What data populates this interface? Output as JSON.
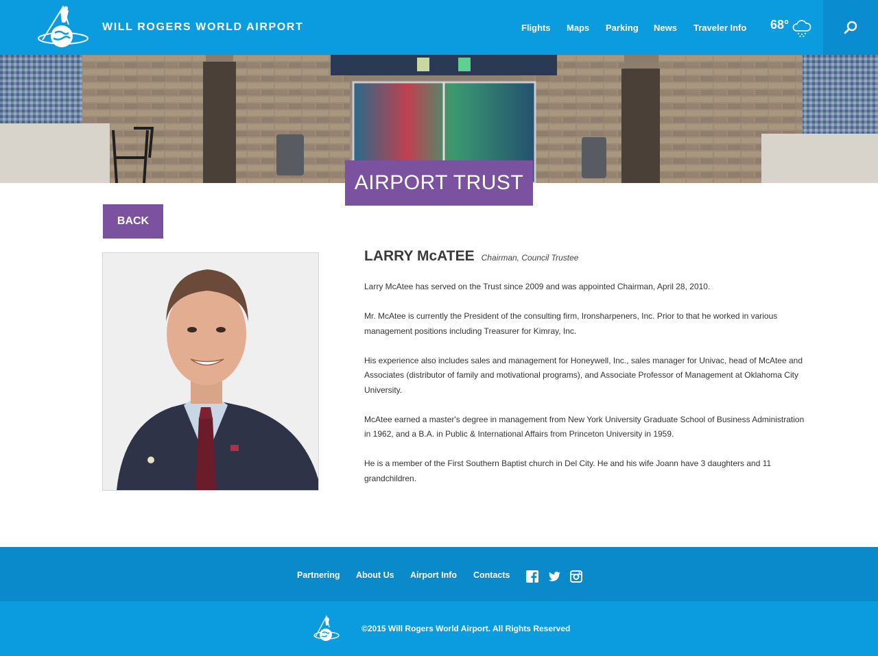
{
  "header": {
    "site_title": "WILL ROGERS WORLD AIRPORT",
    "nav": [
      "Flights",
      "Maps",
      "Parking",
      "News",
      "Traveler Info"
    ],
    "weather": {
      "temperature": "68°",
      "icon": "snow-cloud-icon"
    },
    "search_icon": "search-icon",
    "logo": "airport-logo"
  },
  "page": {
    "title": "AIRPORT TRUST",
    "back_label": "BACK"
  },
  "profile": {
    "name": "LARRY McATEE",
    "role": "Chairman, Council Trustee",
    "paragraphs": [
      "Larry McAtee has served on the Trust since 2009 and was appointed Chairman, April 28, 2010.",
      "Mr. McAtee is currently the President of the consulting firm, Ironsharpeners, Inc. Prior to that he worked in various management positions including Treasurer for Kimray, Inc.",
      "His experience also includes sales and management for Honeywell, Inc., sales manager for Univac, head of McAtee and Associates (distributor of family and motivational programs), and Associate Professor of Management at Oklahoma City University.",
      "McAtee earned a master's degree in management from New York University Graduate School of Business Administration in 1962, and a B.A. in Public & International Affairs from Princeton University in 1959.",
      "He is a member of the First Southern Baptist church in Del City. He and his wife Joann have 3 daughters and 11 grandchildren."
    ]
  },
  "footer": {
    "links": [
      "Partnering",
      "About Us",
      "Airport Info",
      "Contacts"
    ],
    "social": [
      "facebook-icon",
      "twitter-icon",
      "instagram-icon"
    ],
    "copyright": "©2015 Will Rogers World Airport. All Rights Reserved"
  },
  "colors": {
    "header_blue": "#0b9ce0",
    "footer_dark_blue": "#0a8acb",
    "accent_purple": "#7b52a0"
  }
}
